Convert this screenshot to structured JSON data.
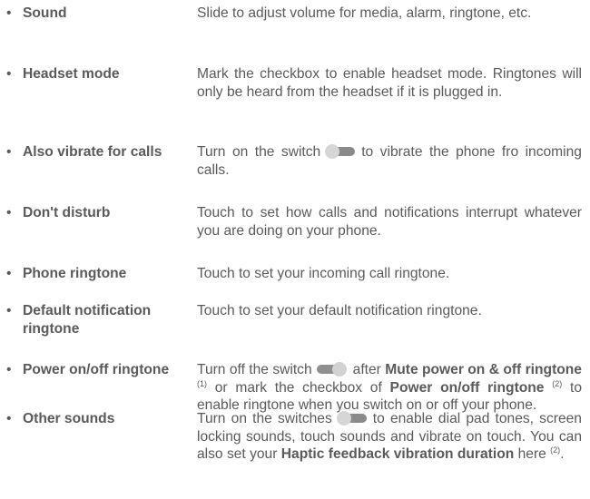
{
  "bullet": "•",
  "items": [
    {
      "term": "Sound",
      "desc": "Slide to adjust volume for media, alarm, ringtone, etc."
    },
    {
      "term": "Headset mode",
      "desc": "Mark the checkbox to enable headset mode. Ringtones will only be heard from the headset if it is plugged in."
    },
    {
      "term": "Also vibrate for calls",
      "desc_a": "Turn on the switch",
      "desc_b": "to vibrate the phone fro incoming calls.",
      "switch_icon": "toggle-switch-off-icon"
    },
    {
      "term": "Don't disturb",
      "desc": "Touch to set how calls and notifications interrupt whatever you are doing on your phone."
    },
    {
      "term": "Phone ringtone",
      "desc": "Touch to set your incoming call ringtone."
    },
    {
      "term": "Default notification ringtone",
      "desc": "Touch to set your default notification ringtone."
    },
    {
      "term": "Power on/off ringtone",
      "desc_a": "Turn off the switch",
      "desc_b": "after",
      "bold_1": "Mute power on & off ringtone",
      "note_1": "(1)",
      "desc_c": "or mark the checkbox of",
      "bold_2": "Power on/off ringtone",
      "note_2": "(2)",
      "desc_d": "to enable ringtone when you switch on or off your phone.",
      "switch_icon": "toggle-switch-on-icon"
    },
    {
      "term": "Other sounds",
      "desc_a": "Turn on the switches",
      "desc_b": "to enable dial pad tones, screen locking sounds, touch sounds and vibrate on touch. You can also set your",
      "bold_1": "Haptic feedback vibration duration",
      "desc_c": "here",
      "note_1": "(2)",
      "desc_d": ".",
      "switch_icon": "toggle-switch-off-icon"
    }
  ]
}
